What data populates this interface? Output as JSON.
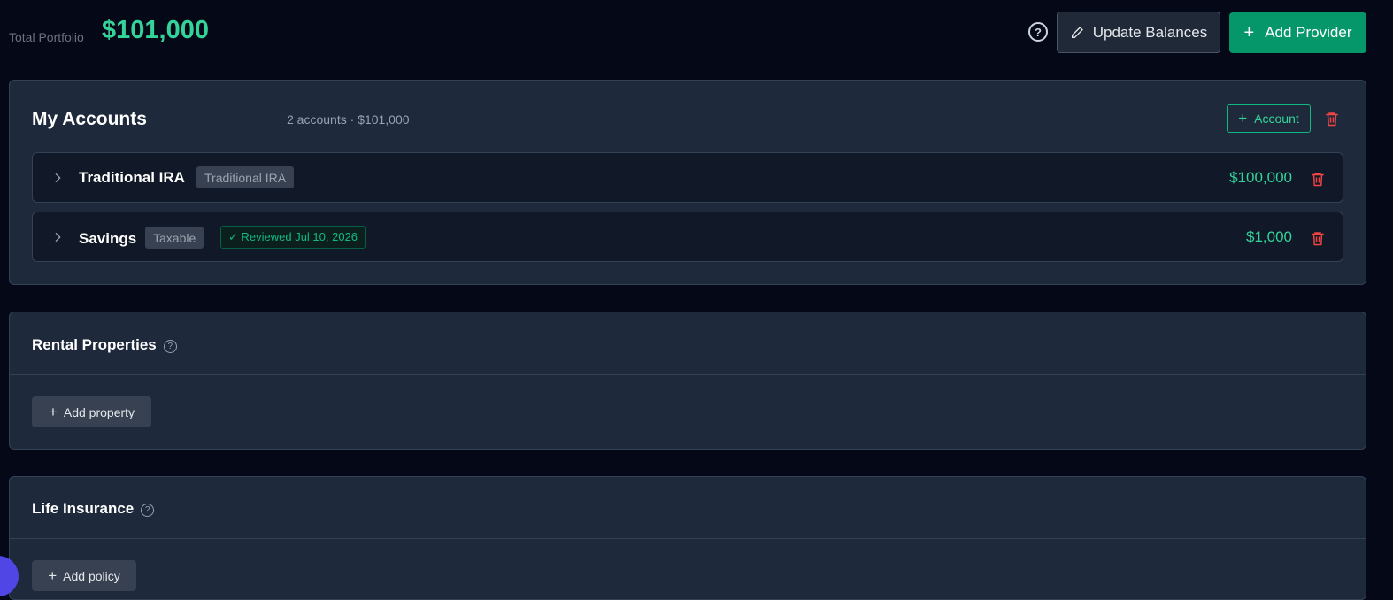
{
  "header": {
    "portfolio_label": "Total Portfolio",
    "portfolio_value": "$101,000",
    "help_icon": "?",
    "update_label": "Update Balances",
    "add_provider_label": "Add Provider"
  },
  "accounts": {
    "title": "My Accounts",
    "summary": "2 accounts · $101,000",
    "add_account_label": "Account",
    "rows": [
      {
        "name": "Traditional IRA",
        "type": "Traditional IRA",
        "value": "$100,000"
      },
      {
        "name": "Savings",
        "type": "Taxable",
        "reviewed": "✓ Reviewed Jul 10, 2026",
        "value": "$1,000"
      }
    ]
  },
  "rental": {
    "title": "Rental Properties",
    "help_icon": "?",
    "add_label": "Add property"
  },
  "life": {
    "title": "Life Insurance",
    "help_icon": "?",
    "add_label": "Add policy"
  },
  "colors": {
    "accent": "#10b981",
    "danger": "#ef4444",
    "background": "#050816",
    "card": "#1e293b"
  }
}
